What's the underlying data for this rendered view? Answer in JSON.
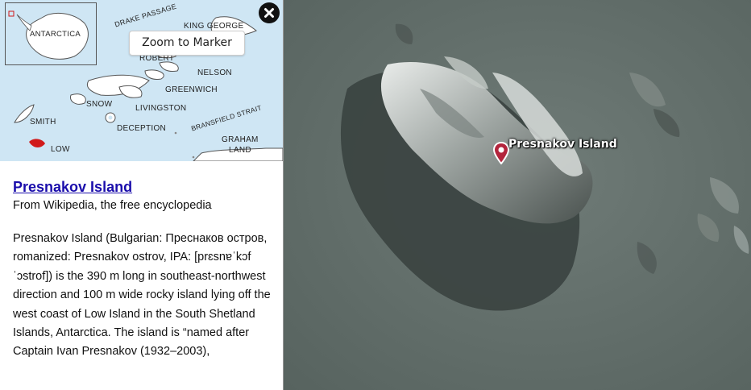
{
  "map": {
    "marker_label": "Presnakov Island",
    "icons": [
      "map-marker-icon"
    ]
  },
  "locator": {
    "inset_label": "ANTARCTICA",
    "labels": {
      "drake_passage": "DRAKE PASSAGE",
      "king_george": "KING GEORGE",
      "robert": "ROBERT",
      "nelson": "NELSON",
      "greenwich": "GREENWICH",
      "snow": "SNOW",
      "livingston": "LIVINGSTON",
      "bransfield_strait": "BRANSFIELD STRAIT",
      "smith": "SMITH",
      "deception": "DECEPTION",
      "graham": "GRAHAM",
      "land": "LAND",
      "low": "LOW"
    },
    "colors": {
      "sea": "#cfe6f4",
      "land": "#ffffff",
      "highlight": "#d11a1a"
    }
  },
  "panel": {
    "zoom_button_label": "Zoom to Marker",
    "close_icon": "close-icon",
    "article_title": "Presnakov Island",
    "article_subtitle": "From Wikipedia, the free encyclopedia",
    "article_body": "Presnakov Island (Bulgarian: Преснаков остров, romanized: Presnakov ostrov, IPA: [prɛsnɐˈkɔf ˈɔstrof]) is the 390 m long in southeast-northwest direction and 100 m wide rocky island lying off the west coast of Low Island in the South Shetland Islands, Antarctica. The island is “named after Captain Ivan Presnakov (1932–2003),"
  }
}
